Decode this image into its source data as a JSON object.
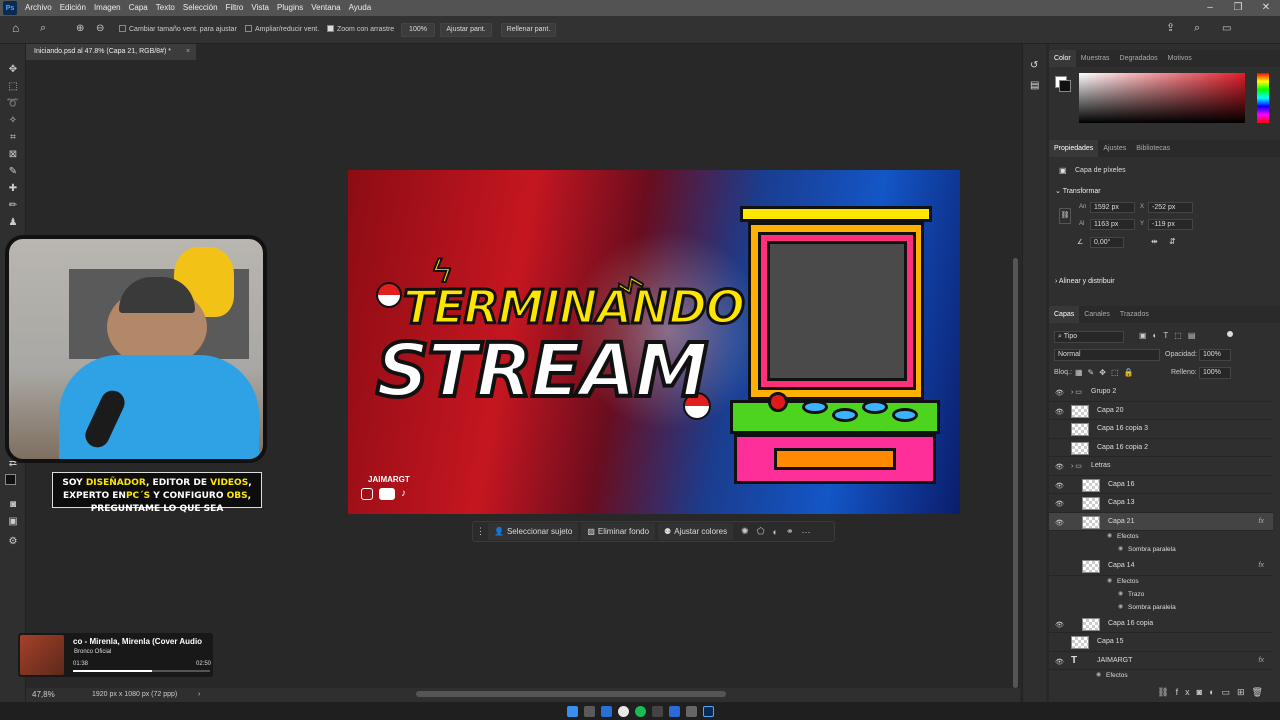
{
  "menu": {
    "app_badge": "Ps",
    "items": [
      "Archivo",
      "Edición",
      "Imagen",
      "Capa",
      "Texto",
      "Selección",
      "Filtro",
      "Vista",
      "Plugins",
      "Ventana",
      "Ayuda"
    ]
  },
  "options_bar": {
    "resize_windows": "Cambiar tamaño vent. para ajustar",
    "zoom_all_windows": "Ampliar/reducir vent.",
    "scrubby_zoom": "Zoom con arrastre",
    "zoom_value": "100%",
    "fit_screen": "Ajustar pant.",
    "fill_screen": "Rellenar pant."
  },
  "document": {
    "tab_title": "Iniciando.psd al 47.8% (Capa 21, RGB/8#) *",
    "zoom": "47,8%",
    "info": "1920 px x 1080 px (72 ppp)"
  },
  "artwork": {
    "title_line1": "TERMINANDO",
    "title_line2": "STREAM",
    "brand": "JAIMARGT"
  },
  "context_bar": {
    "select_subject": "Seleccionar sujeto",
    "remove_bg": "Eliminar fondo",
    "adjust_colors": "Ajustar colores"
  },
  "overlay": {
    "caption_parts": [
      "SOY ",
      "DISEÑADOR",
      ", EDITOR DE ",
      "VIDEOS",
      ", EXPERTO EN",
      "PC´S",
      " Y CONFIGURO ",
      "OBS",
      ", PREGUNTAME LO QUE SEA"
    ],
    "music_title": "co - Mirenla, Mirenla (Cover Audio",
    "music_artist": "Bronco Oficial",
    "music_elapsed": "01:38",
    "music_total": "02:50",
    "music_progress": 0.58
  },
  "color_panel": {
    "tabs": [
      "Color",
      "Muestras",
      "Degradados",
      "Motivos"
    ]
  },
  "properties_panel": {
    "tabs": [
      "Propiedades",
      "Ajustes",
      "Bibliotecas"
    ],
    "layer_type": "Capa de píxeles",
    "transform_label": "Transformar",
    "w_label": "An",
    "w": "1592 px",
    "h_label": "Al",
    "h": "1163 px",
    "x_label": "X",
    "x": "-252 px",
    "y_label": "Y",
    "y": "-119 px",
    "angle": "0,00°",
    "align_label": "Alinear y distribuir"
  },
  "layers_panel": {
    "tabs": [
      "Capas",
      "Canales",
      "Trazados"
    ],
    "filter": "Tipo",
    "blend_mode": "Normal",
    "opacity_label": "Opacidad:",
    "opacity": "100%",
    "lock_label": "Bloq.:",
    "fill_label": "Relleno:",
    "fill": "100%",
    "layers": [
      {
        "name": "Grupo 2",
        "kind": "group",
        "visible": true,
        "indent": 0
      },
      {
        "name": "Capa 20",
        "kind": "layer",
        "visible": true,
        "indent": 0
      },
      {
        "name": "Capa 16 copia 3",
        "kind": "layer",
        "visible": false,
        "indent": 0
      },
      {
        "name": "Capa 16 copia 2",
        "kind": "layer",
        "visible": false,
        "indent": 0
      },
      {
        "name": "Letras",
        "kind": "group",
        "visible": true,
        "indent": 0
      },
      {
        "name": "Capa 16",
        "kind": "layer",
        "visible": true,
        "indent": 1
      },
      {
        "name": "Capa 13",
        "kind": "layer",
        "visible": true,
        "indent": 1
      },
      {
        "name": "Capa 21",
        "kind": "layer",
        "visible": true,
        "indent": 1,
        "fx": "fx",
        "selected": true
      },
      {
        "name": "Efectos",
        "kind": "effect",
        "visible": true,
        "indent": 2
      },
      {
        "name": "Sombra paralela",
        "kind": "effect",
        "visible": true,
        "indent": 3
      },
      {
        "name": "Capa 14",
        "kind": "layer",
        "visible": false,
        "indent": 1,
        "fx": "fx"
      },
      {
        "name": "Efectos",
        "kind": "effect",
        "visible": false,
        "indent": 2
      },
      {
        "name": "Trazo",
        "kind": "effect",
        "visible": false,
        "indent": 3
      },
      {
        "name": "Sombra paralela",
        "kind": "effect",
        "visible": false,
        "indent": 3
      },
      {
        "name": "Capa 16 copia",
        "kind": "layer",
        "visible": true,
        "indent": 1
      },
      {
        "name": "Capa 15",
        "kind": "layer",
        "visible": false,
        "indent": 0
      },
      {
        "name": "JAIMARGT",
        "kind": "text",
        "visible": true,
        "indent": 0,
        "fx": "fx"
      },
      {
        "name": "Efectos",
        "kind": "effect",
        "visible": true,
        "indent": 1
      }
    ]
  }
}
